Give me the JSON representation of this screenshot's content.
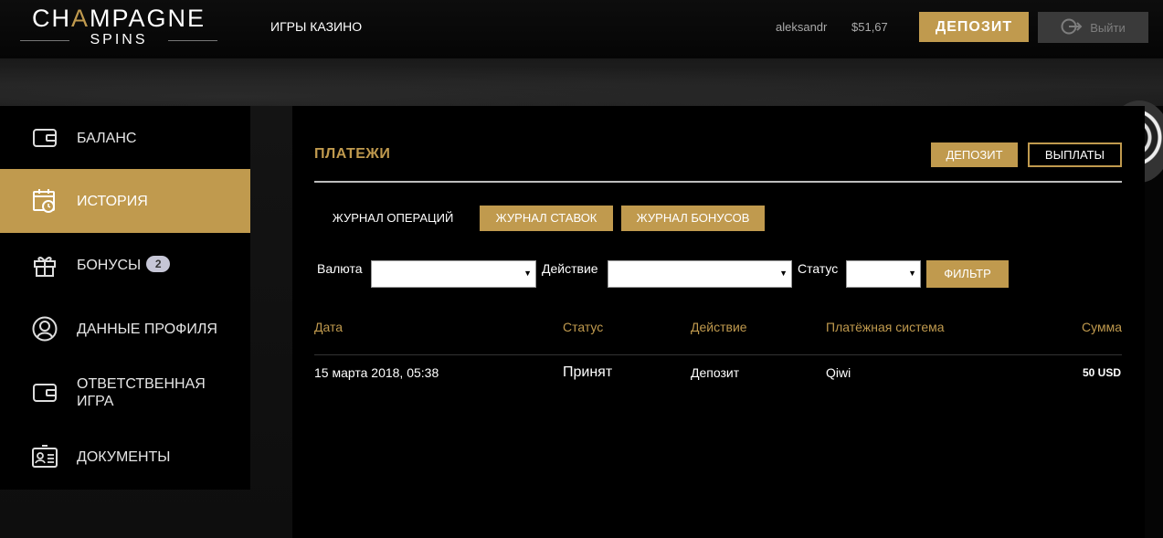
{
  "header": {
    "logo_top_left": "CH",
    "logo_top_mid": "A",
    "logo_top_right": "MPAGNE",
    "logo_bottom": "SPINS",
    "nav_games": "ИГРЫ КАЗИНО",
    "username": "aleksandr",
    "balance": "$51,67",
    "deposit_label": "ДЕПОЗИТ",
    "logout_label": "Выйти"
  },
  "sidebar": {
    "items": [
      {
        "label": "БАЛАНС",
        "icon": "wallet-icon"
      },
      {
        "label": "ИСТОРИЯ",
        "icon": "calendar-clock-icon",
        "active": true
      },
      {
        "label": "БОНУСЫ",
        "icon": "gift-icon",
        "badge": "2"
      },
      {
        "label": "ДАННЫЕ ПРОФИЛЯ",
        "icon": "user-icon"
      },
      {
        "label_line1": "ОТВЕТСТВЕННАЯ",
        "label_line2": "ИГРА",
        "icon": "wallet-icon"
      },
      {
        "label": "ДОКУМЕНТЫ",
        "icon": "id-card-icon"
      }
    ]
  },
  "content": {
    "title": "ПЛАТЕЖИ",
    "deposit_label": "ДЕПОЗИТ",
    "payouts_label": "ВЫПЛАТЫ",
    "tabs": [
      {
        "label": "ЖУРНАЛ ОПЕРАЦИЙ"
      },
      {
        "label": "ЖУРНАЛ СТАВОК"
      },
      {
        "label": "ЖУРНАЛ БОНУСОВ"
      }
    ],
    "filters": {
      "currency_label": "Валюта",
      "action_label": "Действие",
      "status_label": "Статус",
      "filter_button": "ФИЛЬТР"
    },
    "table": {
      "columns": [
        "Дата",
        "Статус",
        "Действие",
        "Платёжная система",
        "Сумма"
      ],
      "rows": [
        {
          "date": "15 марта 2018, 05:38",
          "status": "Принят",
          "action": "Депозит",
          "system": "Qiwi",
          "amount": "50 USD"
        }
      ]
    }
  },
  "colors": {
    "accent": "#c09a4e",
    "background": "#000000"
  }
}
